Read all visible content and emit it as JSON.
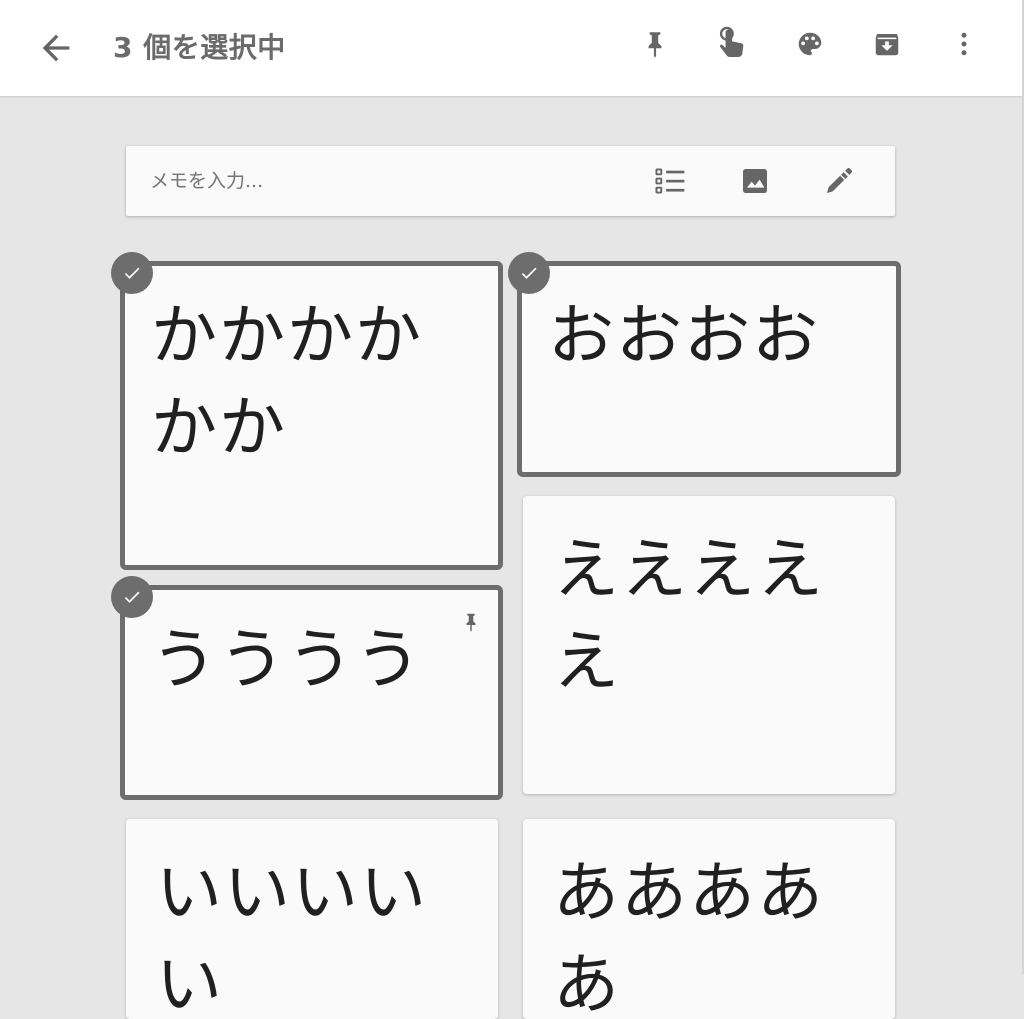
{
  "appbar": {
    "title": "3 個を選択中",
    "icons": [
      "arrow-back-icon",
      "pin-icon",
      "touch-select-icon",
      "palette-icon",
      "archive-icon",
      "more-vert-icon"
    ]
  },
  "take_note": {
    "placeholder": "メモを入力...",
    "icons": [
      "checklist-icon",
      "image-icon",
      "pen-icon"
    ]
  },
  "notes": [
    {
      "text": "かかかかかか",
      "selected": true,
      "pinned": false
    },
    {
      "text": "おおおお",
      "selected": true,
      "pinned": false
    },
    {
      "text": "えええええ",
      "selected": false,
      "pinned": false
    },
    {
      "text": "うううう",
      "selected": true,
      "pinned": true
    },
    {
      "text": "いいいいい",
      "selected": false,
      "pinned": false
    },
    {
      "text": "あああああ",
      "selected": false,
      "pinned": false
    }
  ],
  "colors": {
    "background": "#e6e6e6",
    "card": "#fafafa",
    "selection": "#6d6d6d",
    "icon": "#616161"
  }
}
